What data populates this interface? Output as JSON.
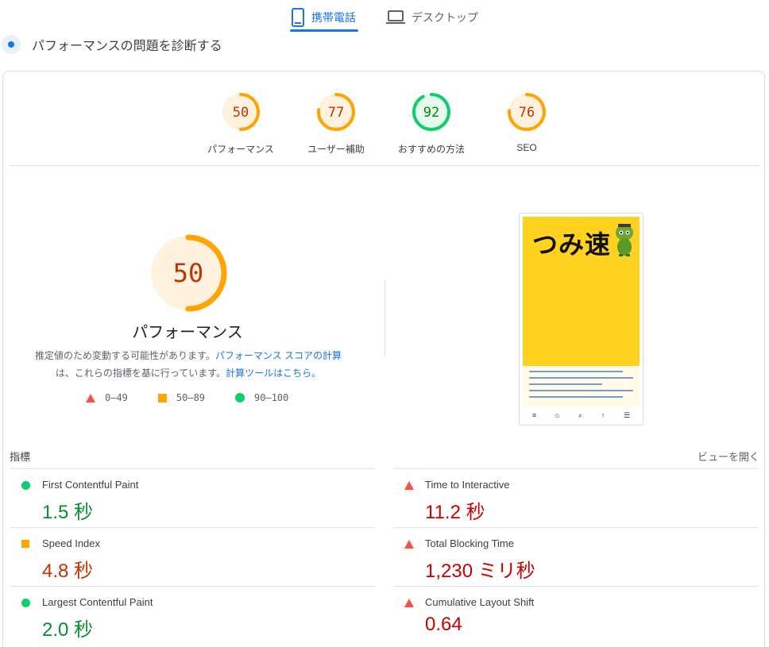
{
  "tabs": {
    "mobile_label": "携帯電話",
    "desktop_label": "デスクトップ"
  },
  "header": {
    "title": "パフォーマンスの問題を診断する"
  },
  "gauges": [
    {
      "score": 50,
      "label": "パフォーマンス",
      "color": "#ffa400",
      "bg": "#fff3e0",
      "text_color": "#c33300"
    },
    {
      "score": 77,
      "label": "ユーザー補助",
      "color": "#ffa400",
      "bg": "#fff3e0",
      "text_color": "#c33300"
    },
    {
      "score": 92,
      "label": "おすすめの方法",
      "color": "#0cce6b",
      "bg": "#e6faef",
      "text_color": "#008800"
    },
    {
      "score": 76,
      "label": "SEO",
      "color": "#ffa400",
      "bg": "#fff3e0",
      "text_color": "#c33300"
    }
  ],
  "performance": {
    "score": 50,
    "label": "パフォーマンス",
    "note_text_1": "推定値のため変動する可能性があります。",
    "note_link_1": "パフォーマンス スコアの計算",
    "note_text_2": "は、これらの指標を基に行っています。",
    "note_link_2": "計算ツールはこちら。"
  },
  "legend": {
    "red_range": "0–49",
    "orange_range": "50–89",
    "green_range": "90–100"
  },
  "preview": {
    "logo_text": "つみ速",
    "nav_icons": [
      "≡",
      "⌂",
      "⌕",
      "↑",
      "☰"
    ]
  },
  "metrics": {
    "header_label": "指標",
    "expand_label": "ビューを開く",
    "left": [
      {
        "name": "First Contentful Paint",
        "value": "1.5 秒",
        "status": "green"
      },
      {
        "name": "Speed Index",
        "value": "4.8 秒",
        "status": "orange"
      },
      {
        "name": "Largest Contentful Paint",
        "value": "2.0 秒",
        "status": "green"
      }
    ],
    "right": [
      {
        "name": "Time to Interactive",
        "value": "11.2 秒",
        "status": "red"
      },
      {
        "name": "Total Blocking Time",
        "value": "1,230 ミリ秒",
        "status": "red"
      },
      {
        "name": "Cumulative Layout Shift",
        "value": "0.64",
        "status": "red"
      }
    ]
  },
  "colors": {
    "accent": "#1a73e8",
    "pass": "#0cce6b",
    "average": "#ffa400",
    "fail": "#ff4e42"
  }
}
